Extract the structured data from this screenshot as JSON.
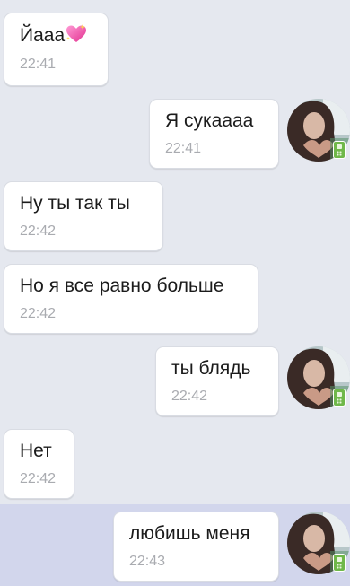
{
  "messages": [
    {
      "text": "Йааа",
      "time": "22:41",
      "direction": "incoming",
      "emoji": "sparkling-heart-icon"
    },
    {
      "text": "Я сукаааа",
      "time": "22:41",
      "direction": "outgoing",
      "avatar": "user-avatar",
      "status_badge": "mobile-online-icon"
    },
    {
      "text": "Ну ты так ты",
      "time": "22:42",
      "direction": "incoming"
    },
    {
      "text": "Но я все равно больше",
      "time": "22:42",
      "direction": "incoming"
    },
    {
      "text": "ты блядь",
      "time": "22:42",
      "direction": "outgoing",
      "avatar": "user-avatar",
      "status_badge": "mobile-online-icon"
    },
    {
      "text": "Нет",
      "time": "22:42",
      "direction": "incoming"
    },
    {
      "text": "любишь меня",
      "time": "22:43",
      "direction": "outgoing",
      "avatar": "user-avatar",
      "status_badge": "mobile-online-icon",
      "selected": true
    }
  ],
  "colors": {
    "background": "#e5e8ef",
    "selected_row": "#d2d6ec",
    "bubble": "#ffffff",
    "time_text": "#a9abb0",
    "online_badge": "#6fb84a"
  }
}
